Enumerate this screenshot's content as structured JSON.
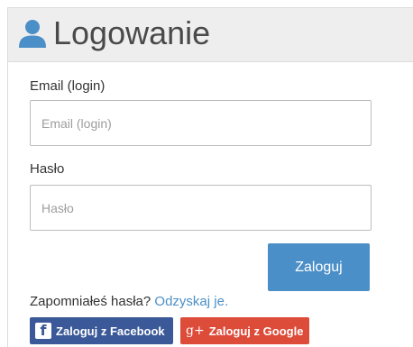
{
  "colors": {
    "header_bg": "#eeeeee",
    "accent": "#4b8fc8",
    "facebook": "#3b5998",
    "google": "#dd4b39"
  },
  "header": {
    "icon": "user-icon",
    "title": "Logowanie"
  },
  "form": {
    "email_label": "Email (login)",
    "email_placeholder": "Email (login)",
    "email_value": "",
    "password_label": "Hasło",
    "password_placeholder": "Hasło",
    "password_value": "",
    "submit_label": "Zaloguj"
  },
  "forgot": {
    "text": "Zapomniałeś hasła?",
    "link": "Odzyskaj je."
  },
  "social": {
    "facebook": {
      "icon": "facebook-icon",
      "label": "Zaloguj z Facebook"
    },
    "google": {
      "icon": "google-plus-icon",
      "icon_text": "g+",
      "label": "Zaloguj z Google"
    }
  }
}
